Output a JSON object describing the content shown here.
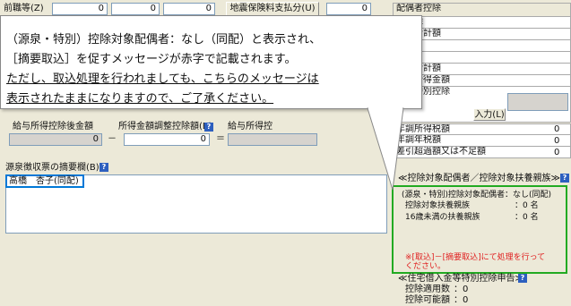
{
  "top_row": {
    "zenshoku_label": "前職等(Z)",
    "zenshoku_values": [
      "0",
      "0",
      "0"
    ],
    "jishin_label": "地震保険料支払分(U)",
    "jishin_value": "0"
  },
  "right_panel": {
    "rows": [
      "配偶者控除",
      "別控除",
      "等の合計額",
      "額",
      "額",
      "額の合計額",
      "給与所得金額",
      "金等特別控除"
    ],
    "nyuryoku_button": "入力(L)",
    "lower_rows": [
      "年調所得税額",
      "年調年税額",
      "差引超過額又は不足額"
    ],
    "values": [
      "0",
      "0",
      "0"
    ]
  },
  "middle_row": {
    "kyuyo_label": "給与所得控除後金額",
    "kyuyo_value": "0",
    "shotoku_label": "所得金額調整控除額(B)",
    "shotoku_value": "0",
    "kyuyo2_label": "給与所得控",
    "op_minus": "－",
    "op_equals": "＝"
  },
  "tekiyo": {
    "label": "源泉徴収票の摘要欄(B)",
    "content": "高橋　杏子(同配)"
  },
  "callout": {
    "line1": "（源泉・特別）控除対象配偶者：なし（同配）と表示され、",
    "line2": "［摘要取込］を促すメッセージが赤字で記載されます。",
    "line3": "ただし、取込処理を行われましても、こちらのメッセージは",
    "line4": "表示されたままになりますので、ご了承ください。"
  },
  "fuyo_section": {
    "header": "≪控除対象配偶者／控除対象扶養親族≫",
    "row1": "(源泉・特別)控除対象配偶者：なし(同配)",
    "row2_label": "控除対象扶養親族",
    "row2_value": "：0 名",
    "row3_label": "16歳未満の扶養親族",
    "row3_value": "：0 名",
    "warning": "※[取込]－[摘要取込]にて処理を行って\nください。"
  },
  "jutaku_section": {
    "header": "≪住宅借入金等特別控除申告≫",
    "row1_label": "控除適用数",
    "row1_value": "：0",
    "row2_label": "控除可能額",
    "row2_value": "：0"
  },
  "colors": {
    "accent_blue": "#0078d7",
    "frame_green": "#22aa22",
    "warning_red": "#e02020"
  }
}
